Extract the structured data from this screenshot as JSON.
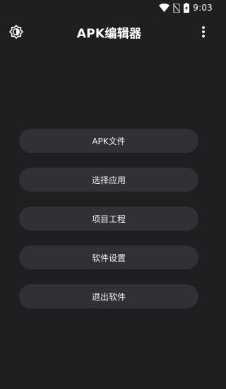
{
  "status_bar": {
    "time": "9:03",
    "icons": [
      "wifi-icon",
      "no-sim-icon",
      "battery-charging-icon"
    ]
  },
  "app_bar": {
    "title": "APK编辑器",
    "left_icon": "brightness-icon",
    "right_icon": "more-vert-icon"
  },
  "menu": {
    "items": [
      {
        "label": "APK文件"
      },
      {
        "label": "选择应用"
      },
      {
        "label": "项目工程"
      },
      {
        "label": "软件设置"
      },
      {
        "label": "退出软件"
      }
    ]
  },
  "colors": {
    "background": "#1e1f21",
    "button": "#303134",
    "text": "#ffffff"
  }
}
